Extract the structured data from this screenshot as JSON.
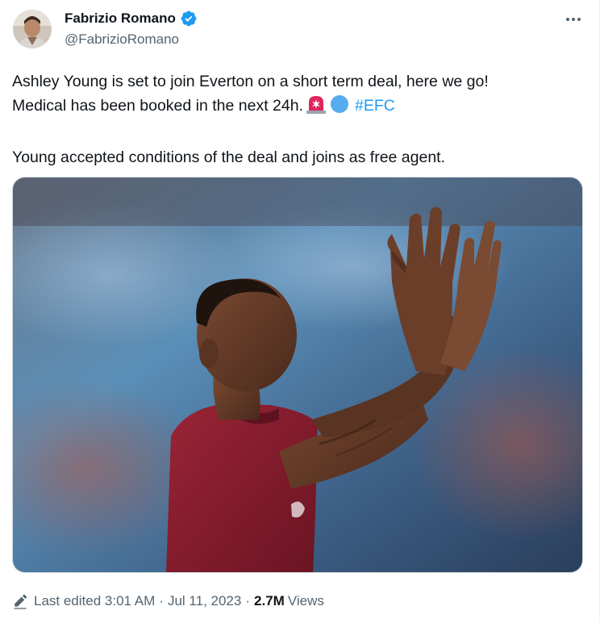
{
  "author": {
    "display_name": "Fabrizio Romano",
    "handle": "@FabrizioRomano",
    "verified": true,
    "avatar_icon": "profile-photo"
  },
  "tweet": {
    "line1": "Ashley Young is set to join Everton on a short term deal, here we go!",
    "line2": "Medical has been booked in the next 24h.",
    "emojis": [
      "rotating-light-emoji",
      "blue-circle-emoji"
    ],
    "hashtag": "#EFC",
    "line3": "Young accepted conditions of the deal and joins as free agent."
  },
  "media": {
    "description_icon": "player-applauding-photo"
  },
  "meta": {
    "edited_label": "Last edited",
    "time": "3:01 AM",
    "separator": "·",
    "date": "Jul 11, 2023",
    "views_count": "2.7M",
    "views_label": "Views"
  },
  "colors": {
    "accent": "#1d9bf0",
    "text": "#0f1419",
    "secondary": "#536471",
    "jersey": "#8a1d2c"
  },
  "icons": {
    "verified": "verified-badge-icon",
    "more": "more-options-icon",
    "edit": "edit-pencil-icon"
  }
}
